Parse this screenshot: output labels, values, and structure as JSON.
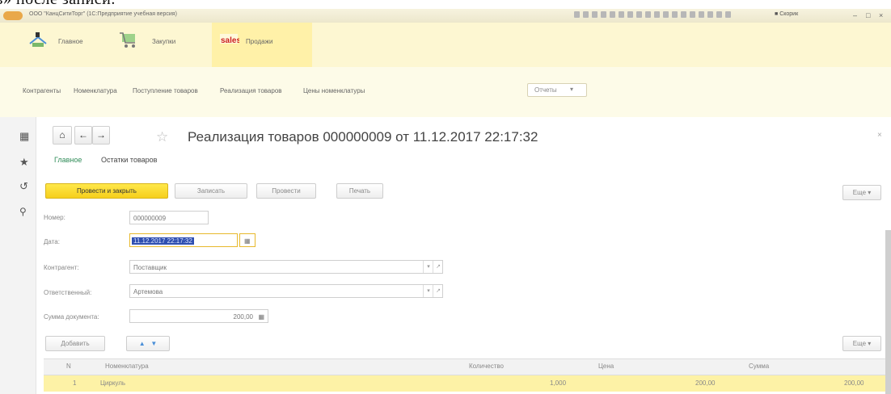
{
  "top_text": "в» после записи.",
  "window": {
    "title": "ООО \"КанцСитиТорг\" (1С:Предприятие учебная версия)",
    "user": "Скорик"
  },
  "sections": [
    {
      "label": "Главное",
      "icon": "home-section-icon"
    },
    {
      "label": "Закупки",
      "icon": "cart-icon"
    },
    {
      "label": "Продажи",
      "icon": "sales-icon"
    }
  ],
  "nav_links": [
    "Контрагенты",
    "Номенклатура",
    "Поступление товаров",
    "Реализация товаров",
    "Цены номенклатуры"
  ],
  "reports_label": "Отчеты",
  "document": {
    "title": "Реализация товаров 000000009 от 11.12.2017 22:17:32",
    "tabs": [
      "Главное",
      "Остатки товаров"
    ],
    "toolbar": {
      "post_close": "Провести и закрыть",
      "save": "Записать",
      "post": "Провести",
      "print": "Печать",
      "more": "Еще"
    },
    "fields": {
      "number_label": "Номер:",
      "number_value": "000000009",
      "date_label": "Дата:",
      "date_value": "11.12.2017 22:17:32",
      "contractor_label": "Контрагент:",
      "contractor_value": "Поставщик",
      "responsible_label": "Ответственный:",
      "responsible_value": "Артемова",
      "sum_label": "Сумма документа:",
      "sum_value": "200,00"
    },
    "table_toolbar": {
      "add": "Добавить",
      "more": "Еще"
    },
    "table": {
      "columns": [
        "N",
        "Номенклатура",
        "Количество",
        "Цена",
        "Сумма"
      ],
      "rows": [
        {
          "n": "1",
          "item": "Циркуль",
          "qty": "1,000",
          "price": "200,00",
          "sum": "200,00"
        }
      ]
    }
  },
  "colors": {
    "accent_yellow": "#f6cf1c",
    "selection_blue": "#2f4fb0",
    "section_bg": "#fdf7d2",
    "tab_active": "#2e8b57"
  }
}
